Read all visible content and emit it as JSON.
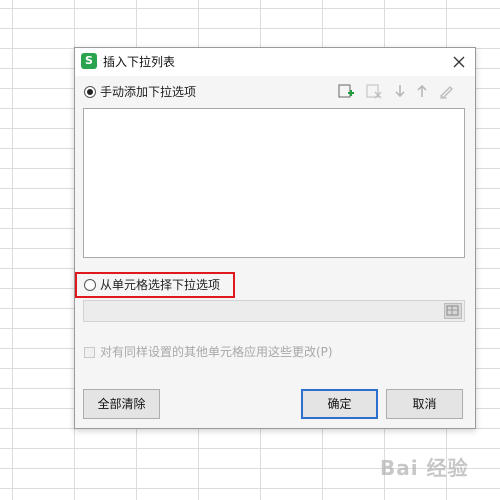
{
  "dialog": {
    "title": "插入下拉列表",
    "app_icon_letter": "S",
    "manual_option_label": "手动添加下拉选项",
    "cell_option_label": "从单元格选择下拉选项",
    "apply_checkbox_label": "对有同样设置的其他单元格应用这些更改(P)",
    "clear_all_button": "全部清除",
    "ok_button": "确定",
    "cancel_button": "取消",
    "toolbar_icons": [
      "add-item-icon",
      "delete-item-icon",
      "move-down-icon",
      "move-up-icon",
      "edit-icon"
    ],
    "selected_option": "manual"
  },
  "colors": {
    "accent_green": "#2aa44f",
    "highlight_red": "#e0191f",
    "primary_border": "#2b6fcf"
  },
  "watermark": "Bai 经验"
}
